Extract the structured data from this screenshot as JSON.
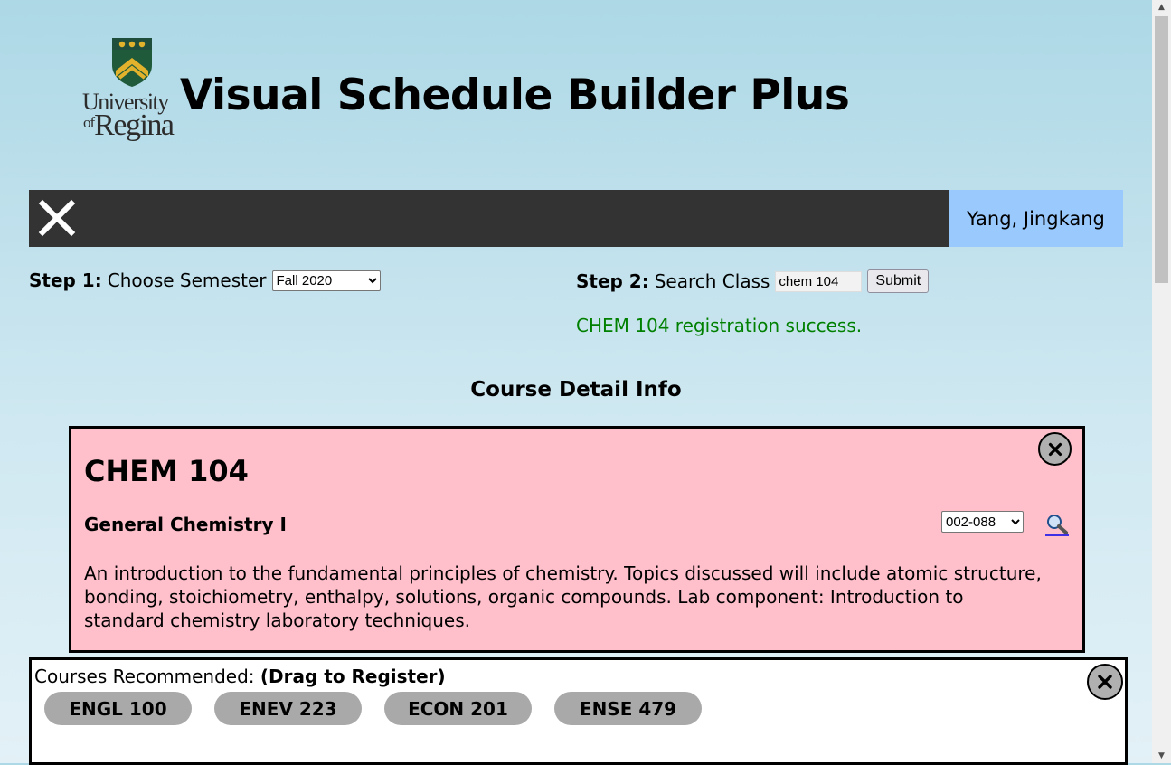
{
  "brand": {
    "university_line1": "University",
    "university_of": "of",
    "university_line2": "Regina",
    "app_title": "Visual Schedule Builder Plus"
  },
  "navbar": {
    "close_icon": "close-icon",
    "user_name": "Yang, Jingkang"
  },
  "step1": {
    "label": "Step 1:",
    "text": "Choose Semester",
    "selected_semester": "Fall 2020"
  },
  "step2": {
    "label": "Step 2:",
    "text": "Search Class",
    "search_value": "chem 104",
    "submit_label": "Submit"
  },
  "status_message": "CHEM 104 registration success.",
  "detail_section": {
    "title": "Course Detail Info"
  },
  "course": {
    "code": "CHEM 104",
    "name": "General Chemistry I",
    "selected_section": "002-088",
    "description": "An introduction to the fundamental principles of chemistry. Topics discussed will include atomic structure, bonding, stoichiometry, enthalpy, solutions, organic compounds. Lab component: Introduction to standard chemistry laboratory techniques."
  },
  "recommended": {
    "label": "Courses Recommended:",
    "hint": "(Drag to Register)",
    "courses": [
      "ENGL 100",
      "ENEV 223",
      "ECON 201",
      "ENSE 479"
    ]
  },
  "colors": {
    "navbar_bg": "#333333",
    "user_box_bg": "#99c9fd",
    "card_bg": "#ffc0cb",
    "status_green": "#008000",
    "pill_bg": "#a9a9a9"
  }
}
